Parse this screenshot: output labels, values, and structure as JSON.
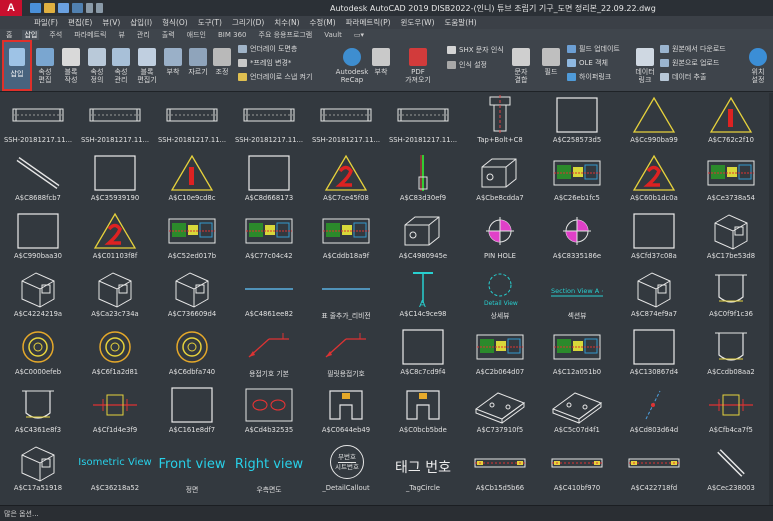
{
  "app": {
    "logo": "A",
    "window_title": "Autodesk AutoCAD 2019    DISB2022-(인니) 튜브 조립기 기구_도면 정리본_22.09.22.dwg"
  },
  "menu": [
    "파일(F)",
    "편집(E)",
    "뷰(V)",
    "삽입(I)",
    "형식(O)",
    "도구(T)",
    "그리기(D)",
    "치수(N)",
    "수정(M)",
    "파라메트릭(P)",
    "윈도우(W)",
    "도움말(H)"
  ],
  "tabs": [
    "홈",
    "삽입",
    "주석",
    "파라메트릭",
    "뷰",
    "관리",
    "출력",
    "애드인",
    "BIM 360",
    "주요 응용프로그램",
    "Vault",
    "▭▾"
  ],
  "active_tab": "삽입",
  "ribbon": {
    "insert": "삽입",
    "attr_edit": "속성\n편집",
    "block_create": "블록\n작성",
    "attr_define": "속성\n정의",
    "attr_manage": "속성\n관리",
    "block_editor": "블록\n편집기",
    "attach": "부착",
    "clip": "자르기",
    "adjust": "조정",
    "underlay_layers": "언더레이 도면층",
    "frame_vary": "*프레임 변경*",
    "underlay_snap": "언더레이로 스냅 켜기",
    "recap": "Autodesk\nReCap",
    "attach2": "부착",
    "pdf_import": "PDF\n가져오기",
    "shx_recognize": "SHX 문자 인식",
    "recognize_settings": "인식 설정",
    "text_match": "문자\n결합",
    "field": "필드",
    "update_fields": "필드 업데이트",
    "ole_object": "OLE 객체",
    "hyperlink": "하이퍼링크",
    "data_link": "데이터\n링크",
    "download_source": "원본에서 다운로드",
    "upload_source": "원본으로 업로드",
    "extract_data": "데이터 추출",
    "location_set": "위치\n설정"
  },
  "palette": [
    {
      "name": "SSH-20181217.11...",
      "kind": "ssh"
    },
    {
      "name": "SSH-20181217.11...",
      "kind": "ssh"
    },
    {
      "name": "SSH-20181217.11...",
      "kind": "ssh"
    },
    {
      "name": "SSH-20181217.11...",
      "kind": "ssh"
    },
    {
      "name": "SSH-20181217.11...",
      "kind": "ssh"
    },
    {
      "name": "SSH-20181217.11...",
      "kind": "ssh"
    },
    {
      "name": "Tap+Bolt+C8",
      "kind": "bolt"
    },
    {
      "name": "A$C258573d5",
      "kind": "rect"
    },
    {
      "name": "A$Cc990ba99",
      "kind": "triangle"
    },
    {
      "name": "A$C762c2f10",
      "kind": "triangle1"
    },
    {
      "name": "A$C8688fcb7",
      "kind": "shaft"
    },
    {
      "name": "A$C35939190",
      "kind": "rect"
    },
    {
      "name": "A$C10e9cd8c",
      "kind": "triangle1"
    },
    {
      "name": "A$C8d668173",
      "kind": "rect"
    },
    {
      "name": "A$C7ce45f08",
      "kind": "triangle2"
    },
    {
      "name": "A$C83d30ef9",
      "kind": "pin"
    },
    {
      "name": "A$Cbe8cdda7",
      "kind": "block"
    },
    {
      "name": "A$C26eb1fc5",
      "kind": "drawing"
    },
    {
      "name": "A$C60b1dc0a",
      "kind": "triangle2"
    },
    {
      "name": "A$Ce3738a54",
      "kind": "drawing"
    },
    {
      "name": "A$C990baa30",
      "kind": "rect"
    },
    {
      "name": "A$C01103f8f",
      "kind": "triangle2"
    },
    {
      "name": "A$C52ed017b",
      "kind": "drawing"
    },
    {
      "name": "A$C77c04c42",
      "kind": "drawing"
    },
    {
      "name": "A$Cddb18a9f",
      "kind": "drawing"
    },
    {
      "name": "A$C4980945e",
      "kind": "block"
    },
    {
      "name": "PIN HOLE",
      "kind": "pinhole"
    },
    {
      "name": "A$C8335186e",
      "kind": "pinhole"
    },
    {
      "name": "A$Cfd37c08a",
      "kind": "rect"
    },
    {
      "name": "A$C17be53d8",
      "kind": "block3d"
    },
    {
      "name": "A$C4224219a",
      "kind": "block3d"
    },
    {
      "name": "A$Ca23c734a",
      "kind": "block3d"
    },
    {
      "name": "A$C736609d4",
      "kind": "block3d"
    },
    {
      "name": "A$C4861ee82",
      "kind": "line"
    },
    {
      "name": "표 줄추가_리비전",
      "kind": "line"
    },
    {
      "name": "A$C14c9ce98",
      "kind": "section"
    },
    {
      "name": "상세뷰",
      "kind": "detail"
    },
    {
      "name": "섹션뷰",
      "kind": "sectionview"
    },
    {
      "name": "A$C874ef9a7",
      "kind": "block3d"
    },
    {
      "name": "A$C0f9f1c36",
      "kind": "cup"
    },
    {
      "name": "A$C0000efeb",
      "kind": "circle"
    },
    {
      "name": "A$C6f1a2d81",
      "kind": "circle"
    },
    {
      "name": "A$C6dbfa740",
      "kind": "circle"
    },
    {
      "name": "용접기호 기본",
      "kind": "weld"
    },
    {
      "name": "필릿용접기호",
      "kind": "weld"
    },
    {
      "name": "A$C8c7cd9f4",
      "kind": "rect"
    },
    {
      "name": "A$C2b064d07",
      "kind": "drawing"
    },
    {
      "name": "A$C12a051b0",
      "kind": "drawing"
    },
    {
      "name": "A$C130867d4",
      "kind": "rect"
    },
    {
      "name": "A$Ccdb08aa2",
      "kind": "cup"
    },
    {
      "name": "A$C4361e8f3",
      "kind": "cup"
    },
    {
      "name": "A$Cf1d4e3f9",
      "kind": "redline"
    },
    {
      "name": "A$C161e8df7",
      "kind": "rect"
    },
    {
      "name": "A$Cd4b32535",
      "kind": "ovals"
    },
    {
      "name": "A$C0644eb49",
      "kind": "channel"
    },
    {
      "name": "A$C0bcb5bde",
      "kind": "channel"
    },
    {
      "name": "A$C737910f5",
      "kind": "plate3d"
    },
    {
      "name": "A$C5c07d4f1",
      "kind": "plate3d"
    },
    {
      "name": "A$Cd803d64d",
      "kind": "dashline"
    },
    {
      "name": "A$Cfb4ca7f5",
      "kind": "redline"
    },
    {
      "name": "A$C17a51918",
      "kind": "block3d"
    },
    {
      "name": "A$C36218a52",
      "kind": "text",
      "text": "Isometric View",
      "size": 10
    },
    {
      "name": "정면",
      "kind": "text",
      "text": "Front view",
      "size": 13
    },
    {
      "name": "우측면도",
      "kind": "text",
      "text": "Right view",
      "size": 13
    },
    {
      "name": "_DetailCallout",
      "kind": "callout",
      "top": "부번호",
      "bottom": "시트번호"
    },
    {
      "name": "_TagCircle",
      "kind": "tag",
      "text": "태그 번호"
    },
    {
      "name": "A$Cb15d5b66",
      "kind": "longbar"
    },
    {
      "name": "A$C410bf970",
      "kind": "longbar"
    },
    {
      "name": "A$C422718fd",
      "kind": "longbar"
    },
    {
      "name": "A$Cec238003",
      "kind": "shaftsm"
    }
  ],
  "status": "많은 옵션..."
}
